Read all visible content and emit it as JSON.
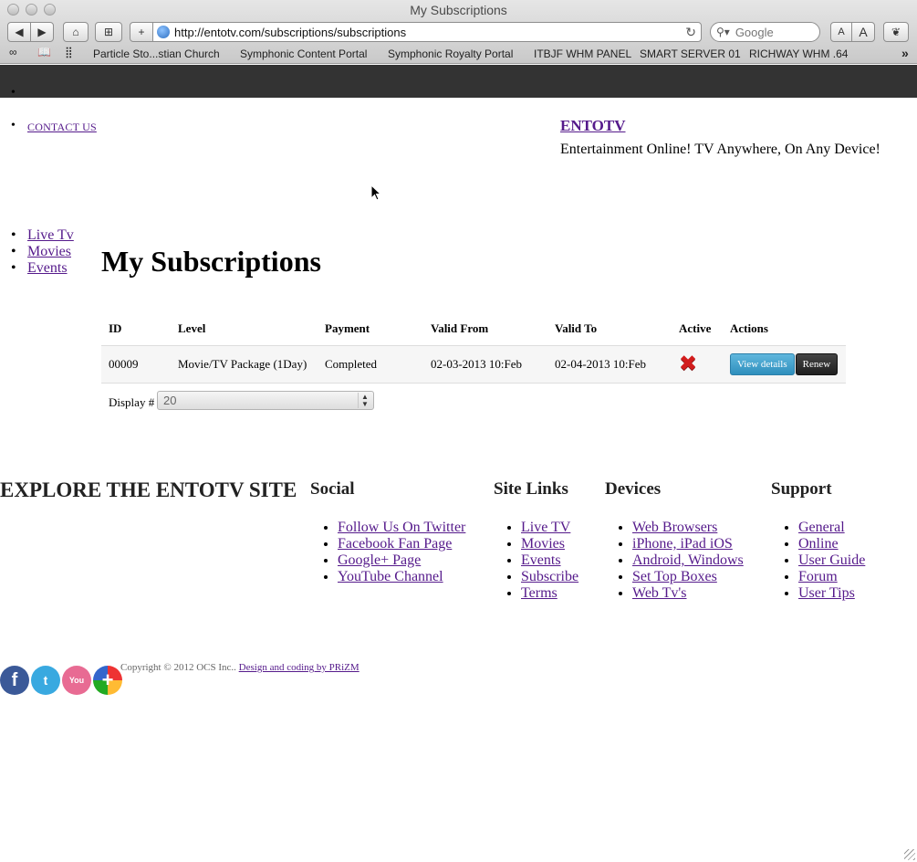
{
  "browser": {
    "window_title": "My Subscriptions",
    "url": "http://entotv.com/subscriptions/subscriptions",
    "search_placeholder": "Google",
    "font_small_label": "A",
    "font_large_label": "A",
    "bookmarks": [
      "Particle Sto...stian Church",
      "Symphonic Content Portal",
      "Symphonic Royalty Portal",
      "ITBJF WHM PANEL",
      "SMART SERVER 01",
      "RICHWAY WHM .64"
    ]
  },
  "header": {
    "contact_link": "CONTACT US",
    "brand_name": "ENTOTV",
    "tagline": "Entertainment Online! TV Anywhere, On Any Device!"
  },
  "side_nav": [
    "Live Tv",
    "Movies",
    "Events"
  ],
  "main": {
    "title": "My Subscriptions",
    "table": {
      "columns": [
        "ID",
        "Level",
        "Payment",
        "Valid From",
        "Valid To",
        "Active",
        "Actions"
      ],
      "rows": [
        {
          "id": "00009",
          "level": "Movie/TV Package (1Day)",
          "payment": "Completed",
          "valid_from": "02-03-2013 10:Feb",
          "valid_to": "02-04-2013 10:Feb",
          "active": "inactive",
          "view_label": "View details",
          "renew_label": "Renew"
        }
      ]
    },
    "display_label": "Display #",
    "display_value": "20"
  },
  "footer": {
    "explore_heading": "EXPLORE THE ENTOTV SITE",
    "social": {
      "heading": "Social",
      "links": [
        "Follow Us On Twitter",
        "Facebook Fan Page",
        "Google+ Page",
        "YouTube Channel"
      ]
    },
    "site_links": {
      "heading": "Site Links",
      "links": [
        "Live TV",
        "Movies",
        "Events",
        "Subscribe",
        "Terms"
      ]
    },
    "devices": {
      "heading": "Devices",
      "links": [
        "Web Browsers",
        "iPhone, iPad iOS",
        "Android, Windows",
        "Set Top Boxes",
        "Web Tv's"
      ]
    },
    "support": {
      "heading": "Support",
      "links": [
        "General",
        "Online",
        "User Guide",
        "Forum",
        "User Tips"
      ]
    },
    "copyright": "Copyright © 2012 OCS Inc..",
    "credit_link": "Design and coding by PRiZM",
    "social_icons": [
      "facebook-icon",
      "twitter-icon",
      "youtube-icon",
      "googleplus-icon"
    ]
  },
  "colors": {
    "top_bar": "#333333",
    "link": "#551a8b",
    "view_button": "#3a9ac6",
    "renew_button": "#2a2a2a",
    "inactive_icon": "#d21c1c"
  }
}
